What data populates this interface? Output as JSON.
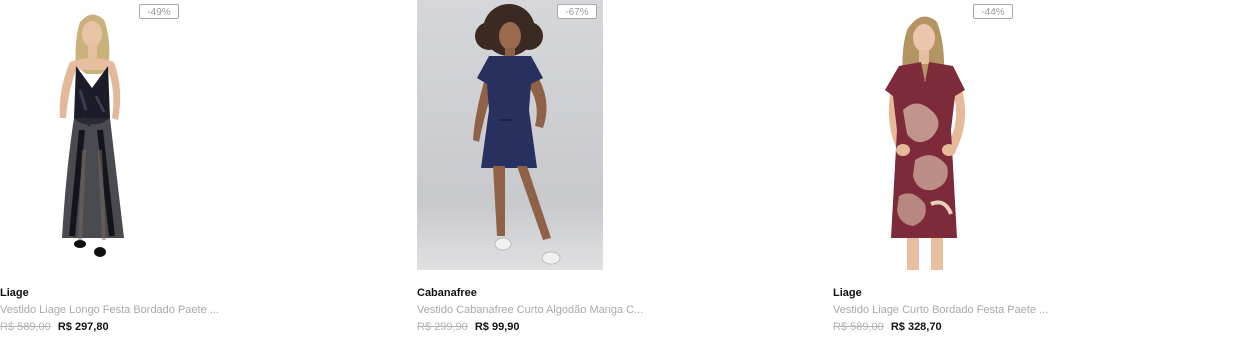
{
  "products": [
    {
      "discount": "-49%",
      "brand": "Liage",
      "name": "Vestido Liage Longo Festa Bordado Paete ...",
      "old_price": "R$ 589,00",
      "price": "R$ 297,80",
      "image": "long-black-sequin-gown-photo"
    },
    {
      "discount": "-67%",
      "brand": "Cabanafree",
      "name": "Vestido Cabanafree Curto Algodão Manga C...",
      "old_price": "R$ 299,90",
      "price": "R$ 99,90",
      "image": "navy-tshirt-dress-photo"
    },
    {
      "discount": "-44%",
      "brand": "Liage",
      "name": "Vestido Liage Curto Bordado Festa Paete ...",
      "old_price": "R$ 589,00",
      "price": "R$ 328,70",
      "image": "burgundy-sequin-short-dress-photo"
    }
  ],
  "colors": {
    "price": "#111111",
    "old_price": "#b3b3b3",
    "name": "#a9a9a9",
    "badge_border": "#a8a8a8"
  }
}
